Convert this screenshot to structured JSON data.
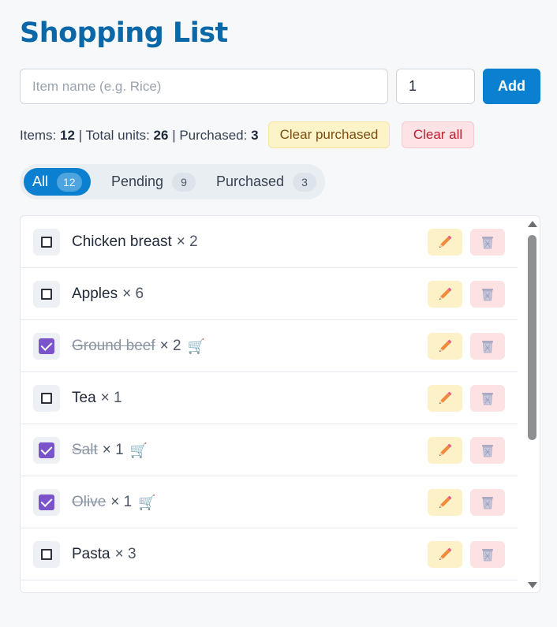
{
  "title": "Shopping List",
  "form": {
    "name_placeholder": "Item name (e.g. Rice)",
    "qty_value": "1",
    "add_label": "Add"
  },
  "stats": {
    "items_label": "Items:",
    "items": "12",
    "units_label": "Total units:",
    "units": "26",
    "purchased_label": "Purchased:",
    "purchased": "3",
    "separator": "|"
  },
  "actions": {
    "clear_purchased": "Clear purchased",
    "clear_all": "Clear all"
  },
  "filters": [
    {
      "label": "All",
      "count": "12",
      "active": true
    },
    {
      "label": "Pending",
      "count": "9",
      "active": false
    },
    {
      "label": "Purchased",
      "count": "3",
      "active": false
    }
  ],
  "items": [
    {
      "name": "Chicken breast",
      "qty": "× 2",
      "purchased": false
    },
    {
      "name": "Apples",
      "qty": "× 6",
      "purchased": false
    },
    {
      "name": "Ground beef",
      "qty": "× 2",
      "purchased": true,
      "cart": "🛒"
    },
    {
      "name": "Tea",
      "qty": "× 1",
      "purchased": false
    },
    {
      "name": "Salt",
      "qty": "× 1",
      "purchased": true,
      "cart": "🛒"
    },
    {
      "name": "Olive",
      "qty": "× 1",
      "purchased": true,
      "cart": "🛒"
    },
    {
      "name": "Pasta",
      "qty": "× 3",
      "purchased": false
    }
  ],
  "colors": {
    "accent": "#0b7fd0",
    "title": "#0b68a8",
    "checked": "#7a55c9",
    "edit_bg": "#fdf1c8",
    "delete_bg": "#fde2e4"
  },
  "icons": {
    "edit": "pencil-icon",
    "delete": "trash-icon",
    "cart": "cart-icon"
  }
}
